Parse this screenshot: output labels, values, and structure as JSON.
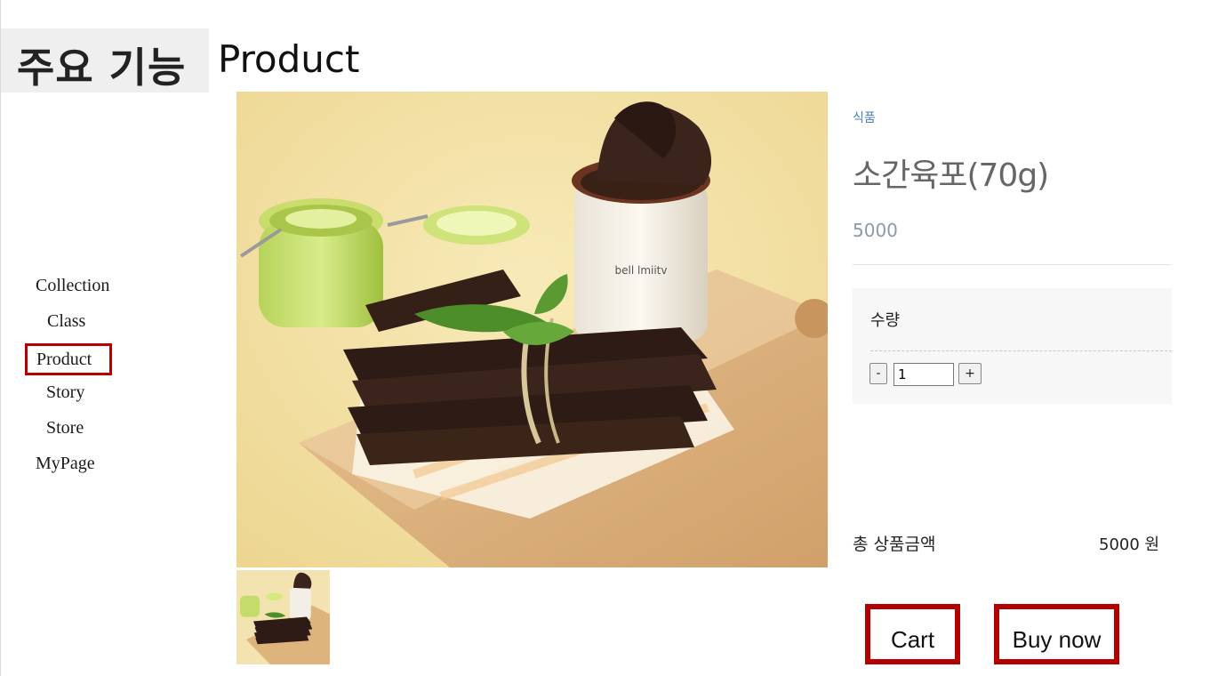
{
  "header": {
    "badge_text": "주요 기능",
    "page_title": "Product"
  },
  "nav": {
    "items": [
      {
        "label": "Collection",
        "selected": false
      },
      {
        "label": "Class",
        "selected": false
      },
      {
        "label": "Product",
        "selected": true
      },
      {
        "label": "Story",
        "selected": false
      },
      {
        "label": "Store",
        "selected": false
      },
      {
        "label": "MyPage",
        "selected": false
      }
    ]
  },
  "product": {
    "category": "식품",
    "name": "소간육포(70g)",
    "price": "5000",
    "quantity_label": "수량",
    "quantity_value": "1",
    "minus_label": "-",
    "plus_label": "+",
    "total_label": "총 상품금액",
    "total_value": "5000 원",
    "jar_label": "bell lmiitv"
  },
  "actions": {
    "cart_label": "Cart",
    "buy_label": "Buy now"
  },
  "colors": {
    "highlight_border": "#b30000",
    "category_text": "#4a7fc0",
    "price_text": "#8a9aa8"
  }
}
